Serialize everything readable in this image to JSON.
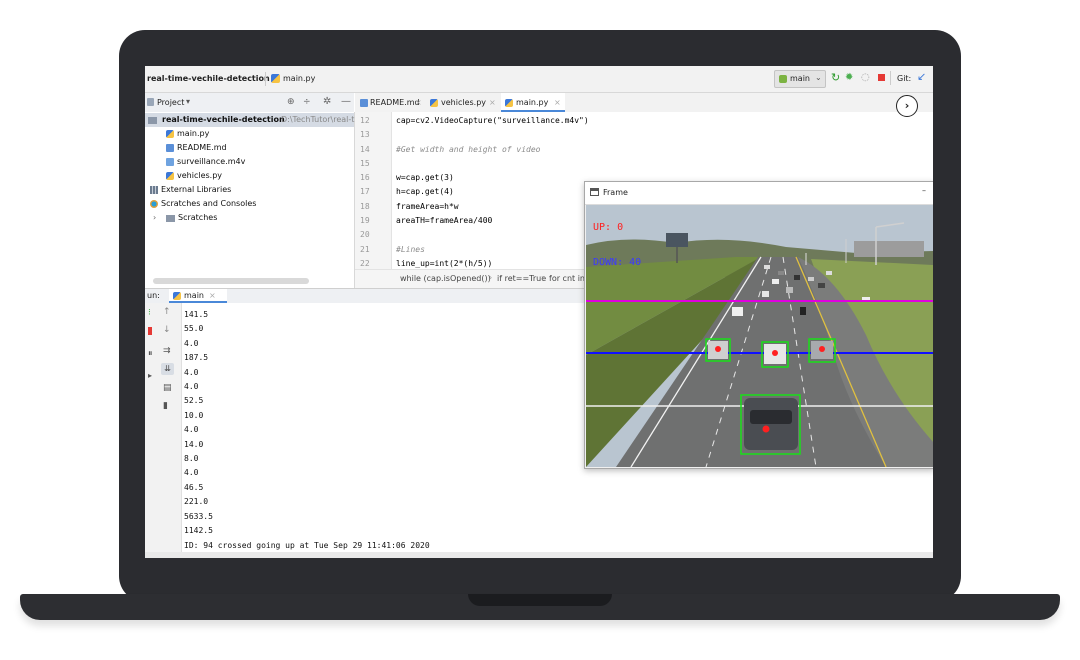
{
  "ide": {
    "title_project": "real-time-vechile-detection",
    "title_file": "main.py",
    "branch": "main",
    "git_label": "Git:",
    "project_panel_label": "Project",
    "tree": [
      {
        "label": "real-time-vechile-detection",
        "path": "D:\\TechTutor\\real-time-v",
        "icon": "folder-icon",
        "indent": 0
      },
      {
        "label": "main.py",
        "icon": "python-file-icon",
        "indent": 2
      },
      {
        "label": "README.md",
        "icon": "markdown-file-icon",
        "indent": 2
      },
      {
        "label": "surveillance.m4v",
        "icon": "video-file-icon",
        "indent": 2
      },
      {
        "label": "vehicles.py",
        "icon": "python-file-icon",
        "indent": 2
      },
      {
        "label": "External Libraries",
        "icon": "library-icon",
        "indent": 0
      },
      {
        "label": "Scratches and Consoles",
        "icon": "scratch-icon",
        "indent": 0
      },
      {
        "label": "Scratches",
        "icon": "folder-icon",
        "indent": 1
      }
    ],
    "tabs": [
      {
        "label": "README.md",
        "active": false
      },
      {
        "label": "vehicles.py",
        "active": false
      },
      {
        "label": "main.py",
        "active": true
      }
    ],
    "code_lines": [
      {
        "n": "12",
        "text": "cap=cv2.VideoCapture(\"surveillance.m4v\")"
      },
      {
        "n": "13",
        "text": ""
      },
      {
        "n": "14",
        "text": "#Get width and height of video"
      },
      {
        "n": "15",
        "text": ""
      },
      {
        "n": "16",
        "text": "w=cap.get(3)"
      },
      {
        "n": "17",
        "text": "h=cap.get(4)"
      },
      {
        "n": "18",
        "text": "frameArea=h*w"
      },
      {
        "n": "19",
        "text": "areaTH=frameArea/400"
      },
      {
        "n": "20",
        "text": ""
      },
      {
        "n": "21",
        "text": "#Lines"
      },
      {
        "n": "22",
        "text": "line_up=int(2*(h/5))"
      }
    ],
    "breadcrumb": [
      "while (cap.isOpened())",
      "if ret==True",
      "for cnt in c"
    ],
    "run_label": "un:",
    "run_tab": "main",
    "console_lines": [
      "141.5",
      "55.0",
      "4.0",
      "187.5",
      "4.0",
      "4.0",
      "52.5",
      "10.0",
      "4.0",
      "14.0",
      "8.0",
      "4.0",
      "46.5",
      "221.0",
      "5633.5",
      "1142.5",
      "ID: 94 crossed going up at Tue Sep 29 11:41:06 2020"
    ]
  },
  "frame_window": {
    "title": "Frame",
    "up_text": "UP: 0",
    "down_text": "DOWN: 40",
    "colors": {
      "up": "#ff2020",
      "down": "#3a3aff",
      "line_up": "#e000e0",
      "line_down": "#1010ff",
      "box": "#18e018"
    }
  }
}
